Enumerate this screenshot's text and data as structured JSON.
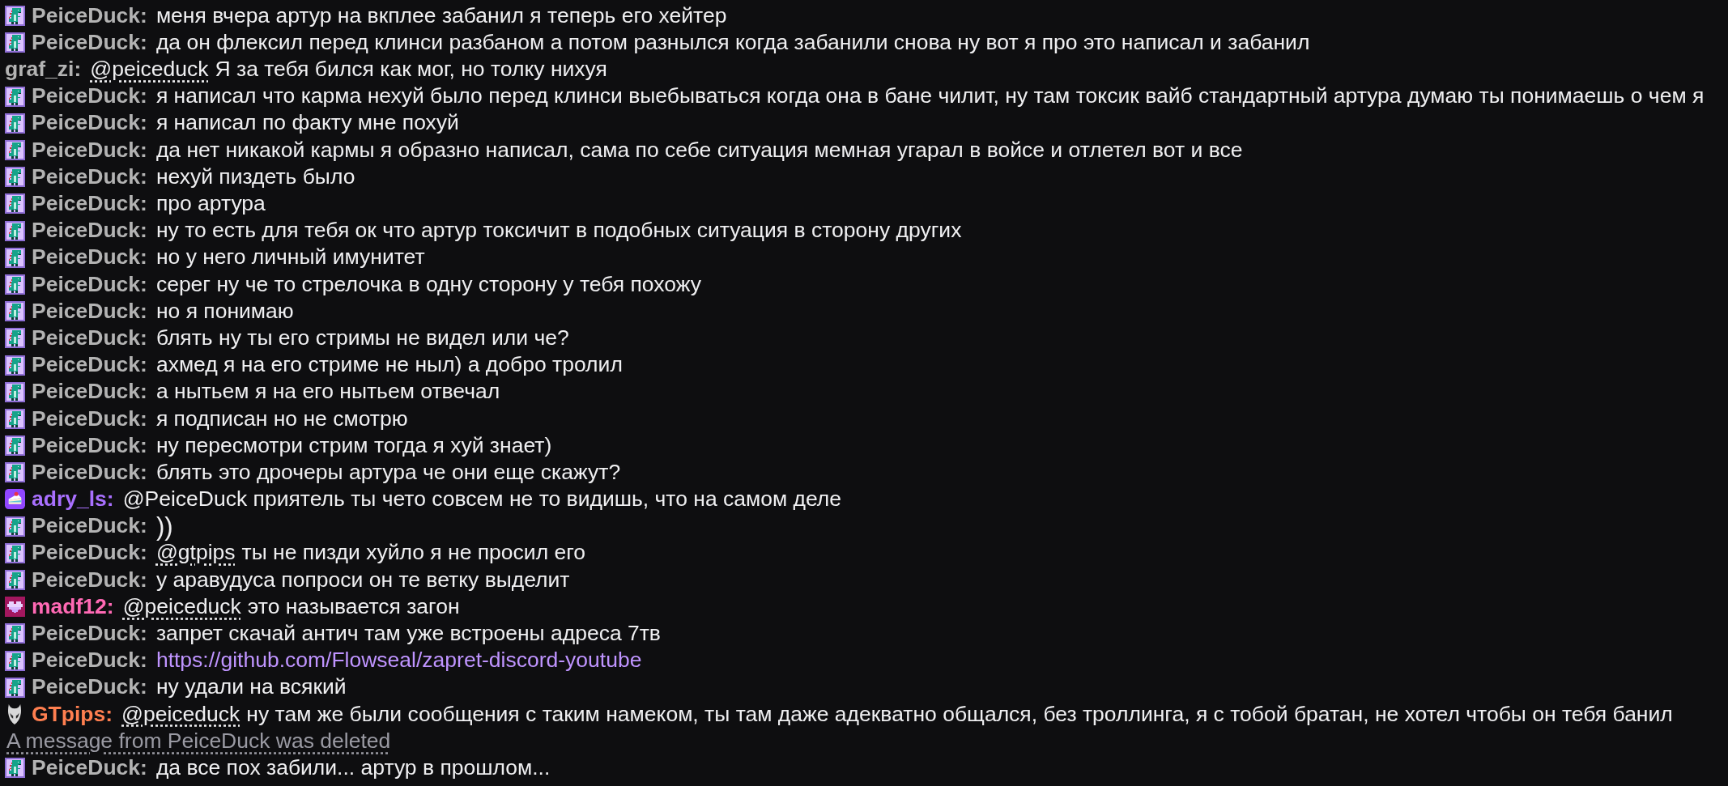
{
  "messages": [
    {
      "kind": "chat",
      "badge": {
        "kind": "dino"
      },
      "user": "PeiceDuck:",
      "color": "#b3b3b3",
      "parts": [
        {
          "kind": "text",
          "text": "меня вчера артур на вкплее забанил я теперь его хейтер"
        }
      ]
    },
    {
      "kind": "chat",
      "badge": {
        "kind": "dino"
      },
      "user": "PeiceDuck:",
      "color": "#b3b3b3",
      "parts": [
        {
          "kind": "text",
          "text": "да он флексил перед клинси разбаном а потом разнылся когда забанили снова ну вот я про это написал и забанил"
        }
      ]
    },
    {
      "kind": "chat",
      "user": "graf_zi:",
      "color": "#b3b3b3",
      "parts": [
        {
          "kind": "mention",
          "text": "@peiceduck"
        },
        {
          "kind": "text",
          "text": "Я за тебя бился как мог, но толку нихуя"
        }
      ]
    },
    {
      "kind": "chat",
      "badge": {
        "kind": "dino"
      },
      "user": "PeiceDuck:",
      "color": "#b3b3b3",
      "parts": [
        {
          "kind": "text",
          "text": "я написал что карма нехуй было перед клинси выебываться когда она в бане чилит, ну там токсик вайб стандартный артура думаю ты понимаешь о чем я"
        }
      ]
    },
    {
      "kind": "chat",
      "badge": {
        "kind": "dino"
      },
      "user": "PeiceDuck:",
      "color": "#b3b3b3",
      "parts": [
        {
          "kind": "text",
          "text": "я написал по факту мне похуй"
        }
      ]
    },
    {
      "kind": "chat",
      "badge": {
        "kind": "dino"
      },
      "user": "PeiceDuck:",
      "color": "#b3b3b3",
      "parts": [
        {
          "kind": "text",
          "text": "да нет никакой кармы я образно написал, сама по себе ситуация мемная угарал в войсе и отлетел вот и все"
        }
      ]
    },
    {
      "kind": "chat",
      "badge": {
        "kind": "dino"
      },
      "user": "PeiceDuck:",
      "color": "#b3b3b3",
      "parts": [
        {
          "kind": "text",
          "text": "нехуй пиздеть было"
        }
      ]
    },
    {
      "kind": "chat",
      "badge": {
        "kind": "dino"
      },
      "user": "PeiceDuck:",
      "color": "#b3b3b3",
      "parts": [
        {
          "kind": "text",
          "text": "про артура"
        }
      ]
    },
    {
      "kind": "chat",
      "badge": {
        "kind": "dino"
      },
      "user": "PeiceDuck:",
      "color": "#b3b3b3",
      "parts": [
        {
          "kind": "text",
          "text": "ну то есть для тебя ок что артур токсичит в подобных ситуация в сторону других"
        }
      ]
    },
    {
      "kind": "chat",
      "badge": {
        "kind": "dino"
      },
      "user": "PeiceDuck:",
      "color": "#b3b3b3",
      "parts": [
        {
          "kind": "text",
          "text": "но у него личный имунитет"
        }
      ]
    },
    {
      "kind": "chat",
      "badge": {
        "kind": "dino"
      },
      "user": "PeiceDuck:",
      "color": "#b3b3b3",
      "parts": [
        {
          "kind": "text",
          "text": "серег ну че то стрелочка в одну сторону у тебя похожу"
        }
      ]
    },
    {
      "kind": "chat",
      "badge": {
        "kind": "dino"
      },
      "user": "PeiceDuck:",
      "color": "#b3b3b3",
      "parts": [
        {
          "kind": "text",
          "text": "но я понимаю"
        }
      ]
    },
    {
      "kind": "chat",
      "badge": {
        "kind": "dino"
      },
      "user": "PeiceDuck:",
      "color": "#b3b3b3",
      "parts": [
        {
          "kind": "text",
          "text": "блять ну ты его стримы не видел или че?"
        }
      ]
    },
    {
      "kind": "chat",
      "badge": {
        "kind": "dino"
      },
      "user": "PeiceDuck:",
      "color": "#b3b3b3",
      "parts": [
        {
          "kind": "text",
          "text": "ахмед я на его стриме не ныл) а добро тролил"
        }
      ]
    },
    {
      "kind": "chat",
      "badge": {
        "kind": "dino"
      },
      "user": "PeiceDuck:",
      "color": "#b3b3b3",
      "parts": [
        {
          "kind": "text",
          "text": "а нытьем я на его нытьем отвечал"
        }
      ]
    },
    {
      "kind": "chat",
      "badge": {
        "kind": "dino"
      },
      "user": "PeiceDuck:",
      "color": "#b3b3b3",
      "parts": [
        {
          "kind": "text",
          "text": "я подписан но не смотрю"
        }
      ]
    },
    {
      "kind": "chat",
      "badge": {
        "kind": "dino"
      },
      "user": "PeiceDuck:",
      "color": "#b3b3b3",
      "parts": [
        {
          "kind": "text",
          "text": "ну пересмотри стрим тогда я хуй знает)"
        }
      ]
    },
    {
      "kind": "chat",
      "badge": {
        "kind": "dino"
      },
      "user": "PeiceDuck:",
      "color": "#b3b3b3",
      "parts": [
        {
          "kind": "text",
          "text": "блять это дрочеры артура че они еще скажут?"
        }
      ]
    },
    {
      "kind": "chat",
      "badge": {
        "kind": "cake"
      },
      "user": "adry_ls:",
      "color": "#a970ff",
      "parts": [
        {
          "kind": "text",
          "text": "@PeiceDuck приятель ты чето совсем не то видишь, что на самом деле"
        }
      ]
    },
    {
      "kind": "chat",
      "badge": {
        "kind": "dino"
      },
      "user": "PeiceDuck:",
      "color": "#b3b3b3",
      "parts": [
        {
          "kind": "large",
          "text": "))"
        }
      ]
    },
    {
      "kind": "chat",
      "badge": {
        "kind": "dino"
      },
      "user": "PeiceDuck:",
      "color": "#b3b3b3",
      "parts": [
        {
          "kind": "mention",
          "text": "@gtpips"
        },
        {
          "kind": "text",
          "text": "ты не пизди хуйло я не просил его"
        }
      ]
    },
    {
      "kind": "chat",
      "badge": {
        "kind": "dino"
      },
      "user": "PeiceDuck:",
      "color": "#b3b3b3",
      "parts": [
        {
          "kind": "text",
          "text": "у аравудуса попроси он те ветку выделит"
        }
      ]
    },
    {
      "kind": "chat",
      "badge": {
        "kind": "heart"
      },
      "user": "madf12:",
      "color": "#ff69b4",
      "parts": [
        {
          "kind": "mention",
          "text": "@peiceduck"
        },
        {
          "kind": "text",
          "text": "это называется загон"
        }
      ]
    },
    {
      "kind": "chat",
      "badge": {
        "kind": "dino"
      },
      "user": "PeiceDuck:",
      "color": "#b3b3b3",
      "parts": [
        {
          "kind": "text",
          "text": "запрет скачай антич там уже встроены адреса 7тв"
        }
      ]
    },
    {
      "kind": "chat",
      "badge": {
        "kind": "dino"
      },
      "user": "PeiceDuck:",
      "color": "#b3b3b3",
      "parts": [
        {
          "kind": "link",
          "text": "https://github.com/Flowseal/zapret-discord-youtube"
        }
      ]
    },
    {
      "kind": "chat",
      "badge": {
        "kind": "dino"
      },
      "user": "PeiceDuck:",
      "color": "#b3b3b3",
      "parts": [
        {
          "kind": "text",
          "text": "ну удали на всякий"
        }
      ]
    },
    {
      "kind": "chat",
      "badge": {
        "kind": "mask"
      },
      "user": "GTpips:",
      "color": "#ff7f50",
      "parts": [
        {
          "kind": "mention",
          "text": "@peiceduck"
        },
        {
          "kind": "text",
          "text": "ну там же были сообщения с таким намеком, ты там даже адекватно общался, без троллинга, я с тобой братан, не хотел чтобы он тебя банил"
        }
      ]
    },
    {
      "kind": "deleted",
      "text": "A message from PeiceDuck was deleted"
    },
    {
      "kind": "chat",
      "badge": {
        "kind": "dino"
      },
      "user": "PeiceDuck:",
      "color": "#b3b3b3",
      "parts": [
        {
          "kind": "text",
          "text": "да все пох забили... артур в прошлом..."
        }
      ]
    }
  ]
}
